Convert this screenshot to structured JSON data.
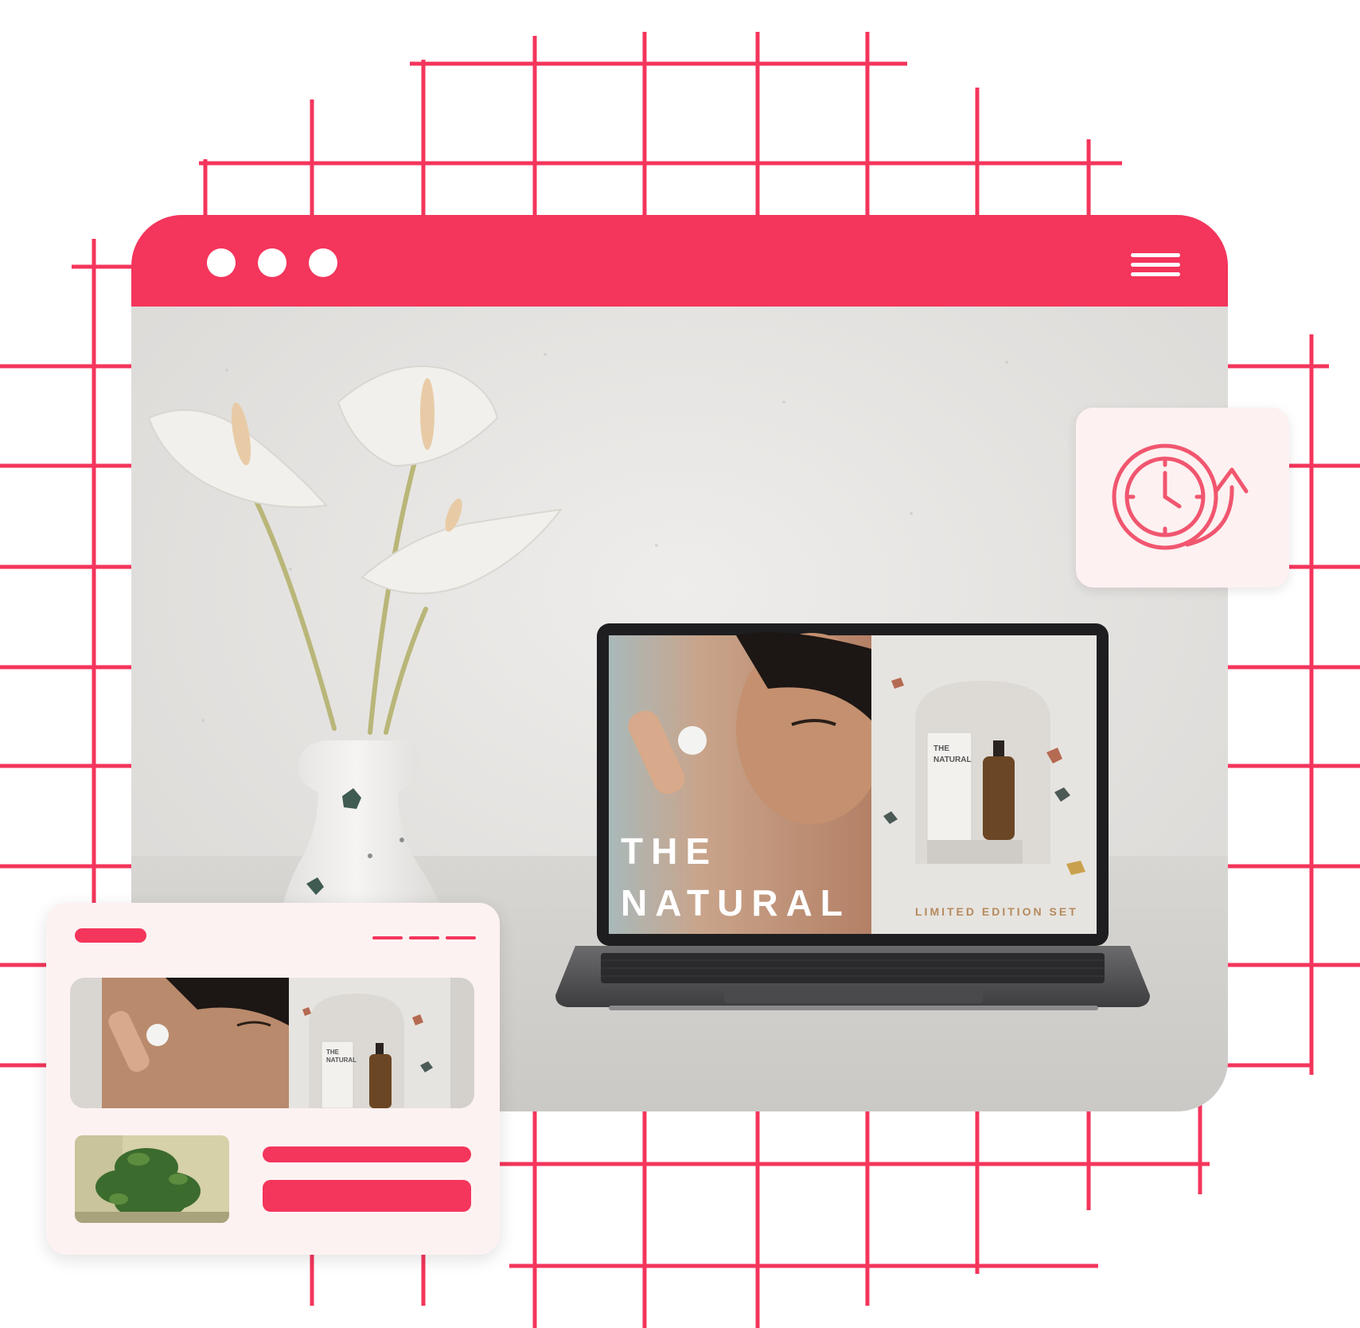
{
  "window": {
    "titlebar_color": "#f4355c",
    "dots": [
      "window-dot",
      "window-dot",
      "window-dot"
    ],
    "menu_icon": "hamburger-menu-icon"
  },
  "laptop_screen": {
    "headline_line1": "THE",
    "headline_line2": "NATURAL",
    "caption": "LIMITED EDITION SET",
    "box_label_line1": "THE",
    "box_label_line2": "NATURAL"
  },
  "clock_card": {
    "icon": "clock-refresh-icon"
  },
  "preview_card": {
    "box_label_line1": "THE",
    "box_label_line2": "NATURAL"
  },
  "colors": {
    "accent": "#f4355c",
    "card_bg": "#fdf2f2",
    "grid": "#f4355c"
  }
}
